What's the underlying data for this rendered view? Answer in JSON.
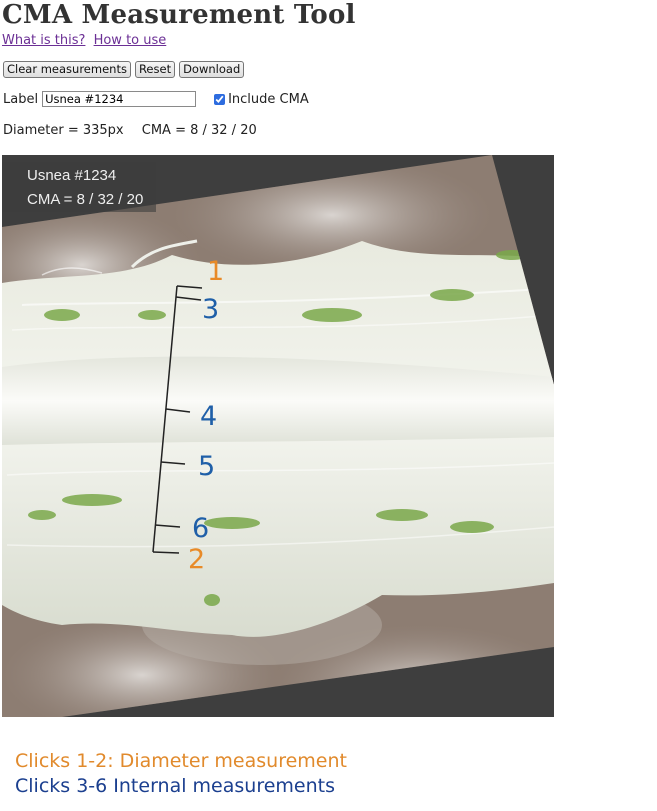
{
  "app": {
    "title": "CMA Measurement Tool"
  },
  "links": {
    "what": "What is this?",
    "how": "How to use"
  },
  "toolbar": {
    "clear": "Clear measurements",
    "reset": "Reset",
    "download": "Download"
  },
  "label_field": {
    "label": "Label",
    "value": "Usnea #1234"
  },
  "include_cma": {
    "label": "Include CMA",
    "checked": true
  },
  "readout": {
    "diameter": "Diameter = 335px",
    "cma": "CMA = 8 / 32 / 20"
  },
  "overlay": {
    "name": "Usnea #1234",
    "cma": "CMA = 8 / 32 / 20"
  },
  "markers": {
    "m1": "1",
    "m2": "2",
    "m3": "3",
    "m4": "4",
    "m5": "5",
    "m6": "6"
  },
  "legend": {
    "diameter": "Clicks 1-2: Diameter measurement",
    "internal": "Clicks 3-6 Internal measurements"
  },
  "colors": {
    "diameter_marker": "#e88a27",
    "internal_marker": "#1f5fa8",
    "link": "#6b2f95",
    "canvas_bg": "#3e3e3e"
  }
}
